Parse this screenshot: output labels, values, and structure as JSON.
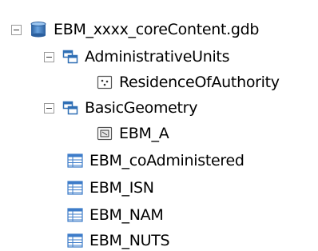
{
  "tree": {
    "root": {
      "label": "EBM_xxxx_coreContent.gdb",
      "icon": "geodatabase-icon",
      "expanded": true
    },
    "datasets": [
      {
        "label": "AdministrativeUnits",
        "icon": "feature-dataset-icon",
        "expanded": true,
        "children": [
          {
            "label": "ResidenceOfAuthority",
            "icon": "point-feature-class-icon"
          }
        ]
      },
      {
        "label": "BasicGeometry",
        "icon": "feature-dataset-icon",
        "expanded": true,
        "children": [
          {
            "label": "EBM_A",
            "icon": "polygon-feature-class-icon"
          }
        ]
      }
    ],
    "tables": [
      {
        "label": "EBM_coAdministered",
        "icon": "table-icon"
      },
      {
        "label": "EBM_ISN",
        "icon": "table-icon"
      },
      {
        "label": "EBM_NAM",
        "icon": "table-icon"
      },
      {
        "label": "EBM_NUTS",
        "icon": "table-icon"
      }
    ]
  },
  "colors": {
    "database_blue": "#4a86c8",
    "dataset_blue": "#2f6fb5",
    "table_blue": "#3d7cc9",
    "expander_border": "#9a9a9a"
  }
}
